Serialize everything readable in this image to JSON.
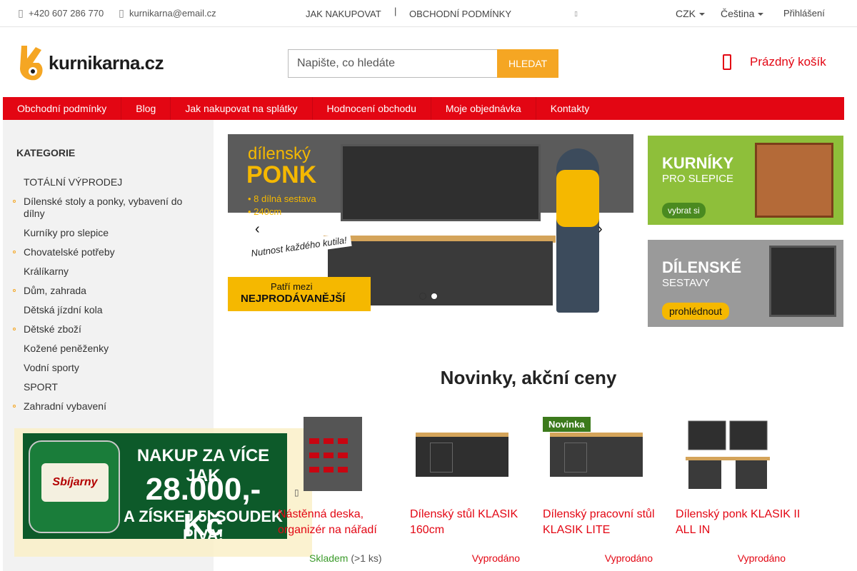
{
  "topbar": {
    "phone": "+420 607 286 770",
    "email": "kurnikarna@email.cz",
    "nav_how_to_buy": "JAK NAKUPOVAT",
    "nav_separator": "|",
    "nav_terms": "OBCHODNÍ PODMÍNKY",
    "currency": "CZK",
    "language": "Čeština",
    "login": "Přihlášení"
  },
  "logo": {
    "text": "kurnikarna.cz"
  },
  "search": {
    "placeholder": "Napište, co hledáte",
    "button": "HLEDAT"
  },
  "cart": {
    "label": "Prázdný košík"
  },
  "mainnav": [
    "Obchodní podmínky",
    "Blog",
    "Jak nakupovat na splátky",
    "Hodnocení obchodu",
    "Moje objednávka",
    "Kontakty"
  ],
  "sidebar": {
    "title": "KATEGORIE",
    "items": [
      {
        "label": "TOTÁLNÍ VÝPRODEJ",
        "has_sub": false
      },
      {
        "label": "Dílenské stoly a ponky, vybavení do dílny",
        "has_sub": true
      },
      {
        "label": "Kurníky pro slepice",
        "has_sub": false
      },
      {
        "label": "Chovatelské potřeby",
        "has_sub": true
      },
      {
        "label": "Králíkarny",
        "has_sub": false
      },
      {
        "label": "Dům, zahrada",
        "has_sub": true
      },
      {
        "label": "Dětská jízdní kola",
        "has_sub": false
      },
      {
        "label": "Dětské zboží",
        "has_sub": true
      },
      {
        "label": "Kožené peněženky",
        "has_sub": false
      },
      {
        "label": "Vodní sporty",
        "has_sub": false
      },
      {
        "label": "SPORT",
        "has_sub": false
      },
      {
        "label": "Zahradní vybavení",
        "has_sub": true
      }
    ]
  },
  "promo": {
    "line1": "NAKUP ZA VÍCE JAK",
    "line2": "28.000,- Kč",
    "line3": "A ZÍSKEJ 5l SOUDEK PIVA!",
    "keg_label": "Sbíjarny"
  },
  "slider": {
    "title1": "dílenský",
    "title2": "PONK",
    "bullet1": "• 8 dílná sestava",
    "bullet2": "• 240cm",
    "tagline": "Nutnost každého kutila!",
    "badge1": "Patří mezi",
    "badge2": "NEJPRODÁVANĚJŠÍ",
    "prev": "‹",
    "next": "›",
    "dots": 2,
    "active_dot": 1
  },
  "side_banners": [
    {
      "heading": "KURNÍKY",
      "sub": "PRO SLEPICE",
      "button": "vybrat si"
    },
    {
      "heading": "DÍLENSKÉ",
      "sub": "SESTAVY",
      "button": "prohlédnout"
    }
  ],
  "section": {
    "title": "Novinky, akční ceny"
  },
  "products": [
    {
      "name": "Nástěnná deska, organizér na nářadí",
      "stock": "Skladem",
      "qty": "(>1 ks)",
      "in_stock": true,
      "tag": ""
    },
    {
      "name": "Dílenský stůl KLASIK 160cm",
      "stock": "Vyprodáno",
      "qty": "",
      "in_stock": false,
      "tag": ""
    },
    {
      "name": "Dílenský pracovní stůl KLASIK LITE",
      "stock": "Vyprodáno",
      "qty": "",
      "in_stock": false,
      "tag": "Novinka"
    },
    {
      "name": "Dílenský ponk KLASIK II ALL IN",
      "stock": "Vyprodáno",
      "qty": "",
      "in_stock": false,
      "tag": ""
    }
  ],
  "colors": {
    "brand_red": "#e30613",
    "accent_orange": "#f5a623",
    "sidebar_bg": "#f2f2f2",
    "in_stock_green": "#3a9a2a"
  },
  "icons": {
    "phone": "phone-icon",
    "email": "email-icon",
    "cart": "cart-icon",
    "close": "close-icon"
  }
}
